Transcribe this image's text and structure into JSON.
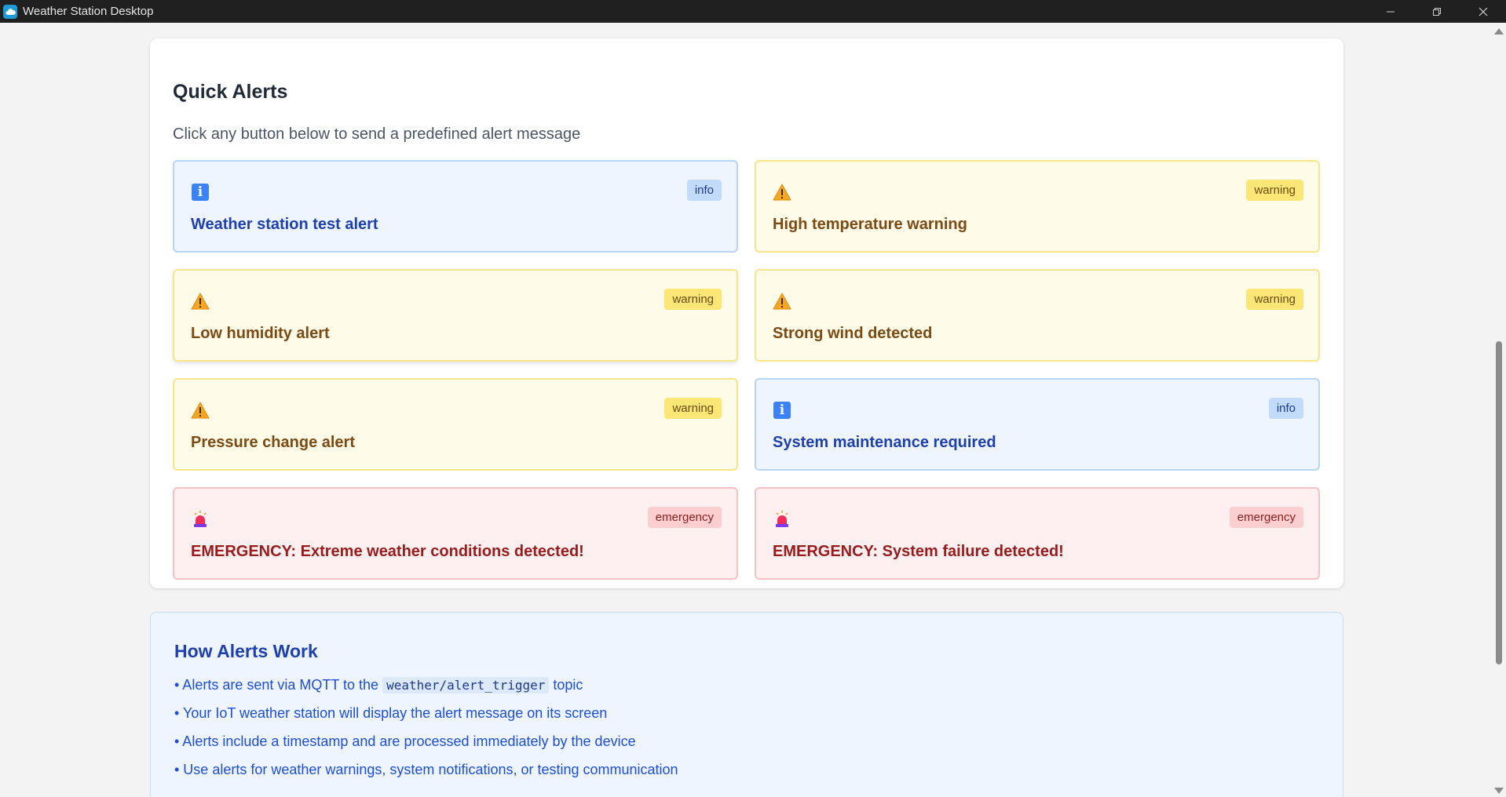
{
  "window": {
    "title": "Weather Station Desktop"
  },
  "quick_alerts": {
    "title": "Quick Alerts",
    "subtitle": "Click any button below to send a predefined alert message",
    "alerts": [
      {
        "label": "Weather station test alert",
        "level": "info",
        "badge": "info",
        "icon": "info-icon"
      },
      {
        "label": "High temperature warning",
        "level": "warning",
        "badge": "warning",
        "icon": "warning-icon"
      },
      {
        "label": "Low humidity alert",
        "level": "warning",
        "badge": "warning",
        "icon": "warning-icon"
      },
      {
        "label": "Strong wind detected",
        "level": "warning",
        "badge": "warning",
        "icon": "warning-icon"
      },
      {
        "label": "Pressure change alert",
        "level": "warning",
        "badge": "warning",
        "icon": "warning-icon"
      },
      {
        "label": "System maintenance required",
        "level": "info",
        "badge": "info",
        "icon": "info-icon"
      },
      {
        "label": "EMERGENCY: Extreme weather conditions detected!",
        "level": "emergency",
        "badge": "emergency",
        "icon": "siren-icon"
      },
      {
        "label": "EMERGENCY: System failure detected!",
        "level": "emergency",
        "badge": "emergency",
        "icon": "siren-icon"
      }
    ]
  },
  "how_alerts_work": {
    "title": "How Alerts Work",
    "item1_prefix": "• Alerts are sent via MQTT to the ",
    "item1_code": "weather/alert_trigger",
    "item1_suffix": " topic",
    "item2": "• Your IoT weather station will display the alert message on its screen",
    "item3": "• Alerts include a timestamp and are processed immediately by the device",
    "item4": "• Use alerts for weather warnings, system notifications, or testing communication"
  },
  "colors": {
    "info": "#3b82f6",
    "warning": "#f59e0b",
    "emergency": "#dc2626"
  }
}
